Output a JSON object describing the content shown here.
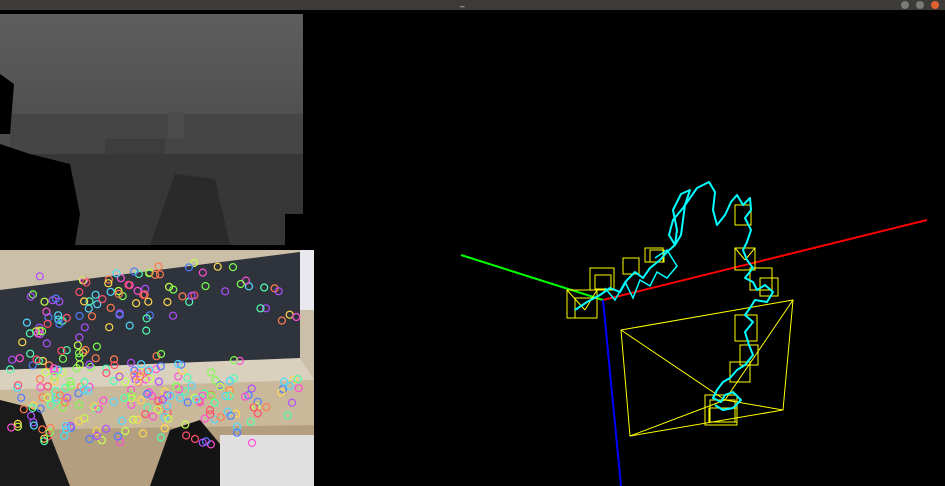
{
  "window": {
    "title": "_",
    "min_icon": "minimize-icon",
    "max_icon": "maximize-icon",
    "close_icon": "close-icon"
  },
  "panels": {
    "depth": "depth-image",
    "rgb": "rgb-image-with-keypoints",
    "map": "3d-trajectory-viewer"
  },
  "colors": {
    "x_axis": "#ff0000",
    "y_axis": "#00ff00",
    "z_axis": "#0000ff",
    "keyframes": "#ffff00",
    "trajectory": "#00ffff"
  }
}
